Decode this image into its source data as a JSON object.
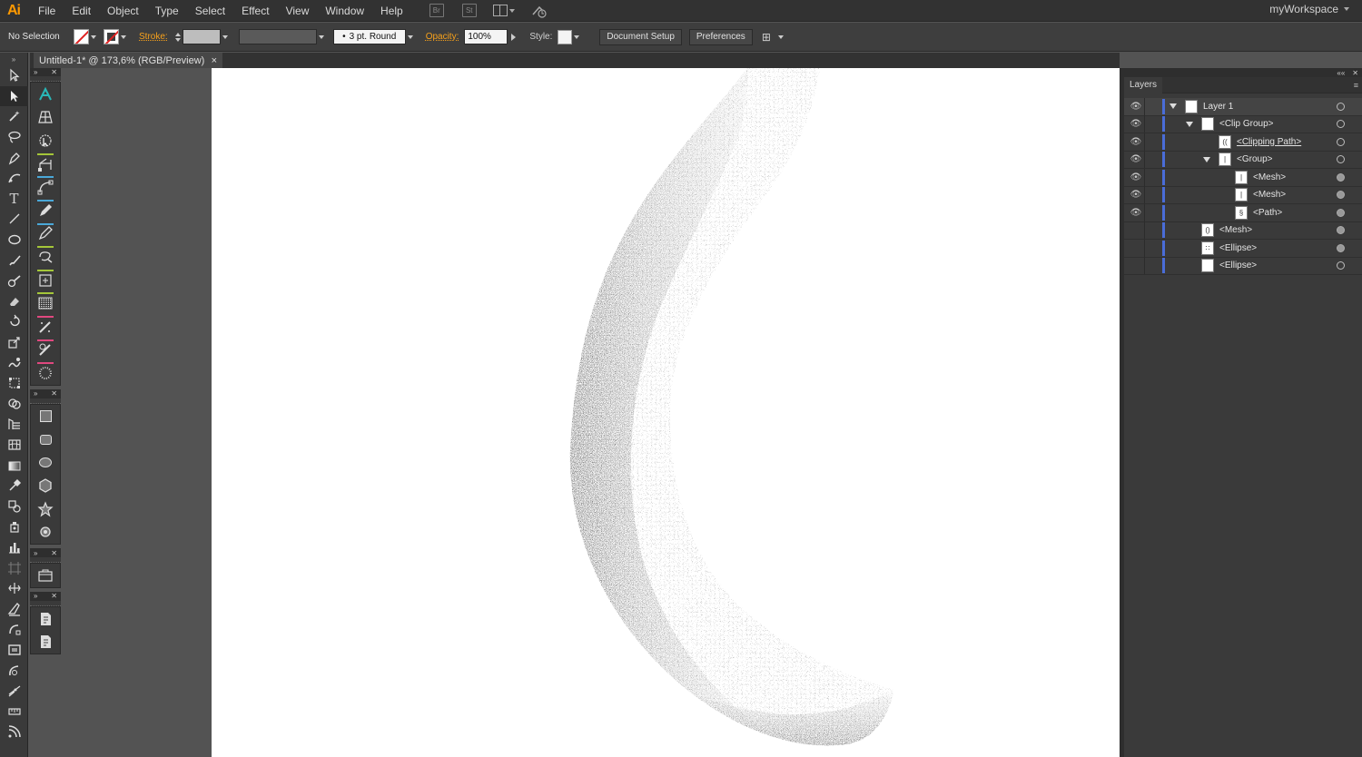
{
  "app": {
    "logo": "Ai",
    "workspace": "myWorkspace",
    "bridge_label": "Br",
    "stock_label": "St"
  },
  "menu": [
    "File",
    "Edit",
    "Object",
    "Type",
    "Select",
    "Effect",
    "View",
    "Window",
    "Help"
  ],
  "control": {
    "selection": "No Selection",
    "stroke_label": "Stroke:",
    "brush": "3 pt. Round",
    "opacity_label": "Opacity:",
    "opacity_value": "100%",
    "style_label": "Style:",
    "document_setup": "Document Setup",
    "preferences": "Preferences"
  },
  "document": {
    "tab_title": "Untitled-1* @ 173,6% (RGB/Preview)",
    "close": "×"
  },
  "layers": {
    "title": "Layers",
    "rows": [
      {
        "name": "Layer 1",
        "visible": true
      },
      {
        "name": "<Clip Group>",
        "visible": true
      },
      {
        "name": "<Clipping Path>",
        "visible": true
      },
      {
        "name": "<Group>",
        "visible": true
      },
      {
        "name": "<Mesh>",
        "visible": true
      },
      {
        "name": "<Mesh>",
        "visible": true
      },
      {
        "name": "<Path>",
        "visible": true
      },
      {
        "name": "<Mesh>",
        "visible": false
      },
      {
        "name": "<Ellipse>",
        "visible": false
      },
      {
        "name": "<Ellipse>",
        "visible": false
      }
    ]
  },
  "colors": {
    "accent_orange": "#f7a11b",
    "layer_color": "#4a6dd8",
    "artboard": "#ffffff",
    "pasteboard": "#535353"
  }
}
